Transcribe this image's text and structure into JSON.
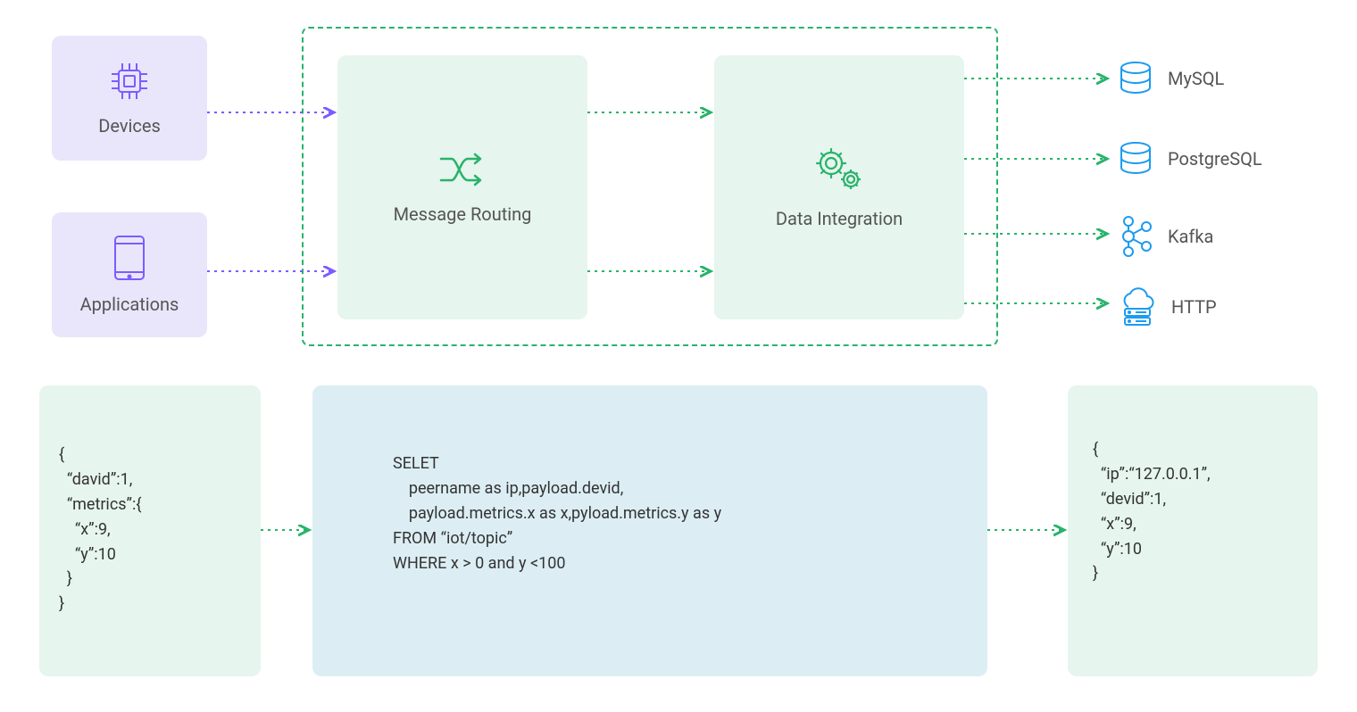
{
  "sources": {
    "devices": "Devices",
    "applications": "Applications"
  },
  "nodes": {
    "routing": "Message Routing",
    "integration": "Data Integration"
  },
  "sinks": {
    "mysql": "MySQL",
    "postgres": "PostgreSQL",
    "kafka": "Kafka",
    "http": "HTTP"
  },
  "input_json": "{\n  “david”:1,\n  “metrics”:{\n    “x”:9,\n    “y”:10\n  }\n}",
  "sql": "SELET\n    peername as ip,payload.devid,\n    payload.metrics.x as x,pyload.metrics.y as y\nFROM “iot/topic”\nWHERE x > 0 and y <100",
  "output_json": "{\n  “ip”:“127.0.0.1”,\n  “devid”:1,\n  “x”:9,\n  “y”:10\n}",
  "colors": {
    "purple": "#7c5cff",
    "green": "#28b36a",
    "blue": "#1d9bf0"
  }
}
